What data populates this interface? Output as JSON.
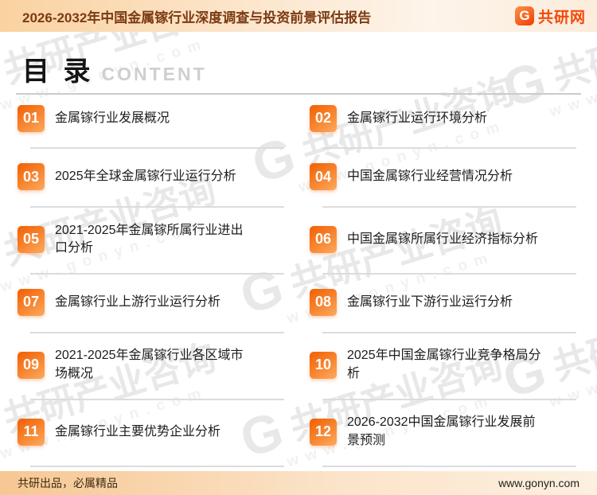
{
  "header": {
    "title": "2026-2032年中国金属镓行业深度调查与投资前景评估报告",
    "logo": {
      "mark": "G",
      "text": "共研网"
    }
  },
  "toc_heading": {
    "cn": "目 录",
    "en": "CONTENT"
  },
  "toc_items": [
    {
      "num": "01",
      "label": "金属镓行业发展概况"
    },
    {
      "num": "02",
      "label": "金属镓行业运行环境分析"
    },
    {
      "num": "03",
      "label": "2025年全球金属镓行业运行分析"
    },
    {
      "num": "04",
      "label": "中国金属镓行业经营情况分析"
    },
    {
      "num": "05",
      "label": "2021-2025年金属镓所属行业进出口分析"
    },
    {
      "num": "06",
      "label": "中国金属镓所属行业经济指标分析"
    },
    {
      "num": "07",
      "label": "金属镓行业上游行业运行分析"
    },
    {
      "num": "08",
      "label": "金属镓行业下游行业运行分析"
    },
    {
      "num": "09",
      "label": "2021-2025年金属镓行业各区域市场概况"
    },
    {
      "num": "10",
      "label": "2025年中国金属镓行业竞争格局分析"
    },
    {
      "num": "11",
      "label": "金属镓行业主要优势企业分析"
    },
    {
      "num": "12",
      "label": "2026-2032中国金属镓行业发展前景预测"
    }
  ],
  "watermark": {
    "mark": "G",
    "text": "共研产业咨询",
    "url": "w w w . g o n y n . c o m"
  },
  "footer": {
    "left": "共研出品，必属精品",
    "right": "www.gonyn.com"
  },
  "colors": {
    "accent_orange": "#f2660c",
    "badge_gradient_end": "#fcaa61",
    "header_peach": "#fad2a0",
    "title_brown": "#7b3a12",
    "logo_red": "#f34a0a",
    "watermark_gray": "#e8e8e8"
  }
}
